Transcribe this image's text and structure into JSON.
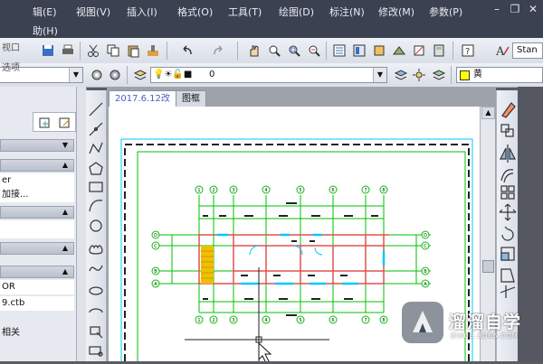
{
  "menubar": {
    "items": [
      {
        "label": "辑(E)"
      },
      {
        "label": "视图(V)"
      },
      {
        "label": "插入(I)"
      },
      {
        "label": "格式(O)"
      },
      {
        "label": "工具(T)"
      },
      {
        "label": "绘图(D)"
      },
      {
        "label": "标注(N)"
      },
      {
        "label": "修改(M)"
      },
      {
        "label": "参数(P)"
      }
    ],
    "second_row": "助(H)"
  },
  "toolbar_standard": {
    "text_style_combo": "Stan"
  },
  "toolbar_layers": {
    "layer_combo_value": "0",
    "color_combo_value": "黄",
    "color_swatch": "#ffff00"
  },
  "left_panel": {
    "rows": [
      "er",
      "加接...",
      "OR",
      "9.ctb",
      "相关"
    ],
    "overlay_text": [
      "视口",
      "选项"
    ]
  },
  "tabs": [
    {
      "label": "2017.6.12改",
      "active": true
    },
    {
      "label": "图框",
      "active": false
    }
  ],
  "drawing": {
    "grid_labels_top": [
      "1",
      "2",
      "3",
      "4",
      "5",
      "6",
      "7",
      "8"
    ],
    "grid_labels_left": [
      "D",
      "C",
      "B",
      "A"
    ],
    "grid_labels_right": [
      "D",
      "C",
      "B",
      "A"
    ],
    "grid_labels_bottom": [
      "1",
      "2",
      "3",
      "4",
      "5",
      "6",
      "7",
      "8"
    ],
    "colors": {
      "grid": "#00c000",
      "wall": "#e05050",
      "window": "#00c8ff",
      "stair": "#f0c000",
      "frame_inner": "#00c000",
      "frame_outer": "#00c8ff"
    }
  },
  "watermark": {
    "brand": "溜溜自学",
    "url": "ZIXUE.3D66.COM"
  }
}
